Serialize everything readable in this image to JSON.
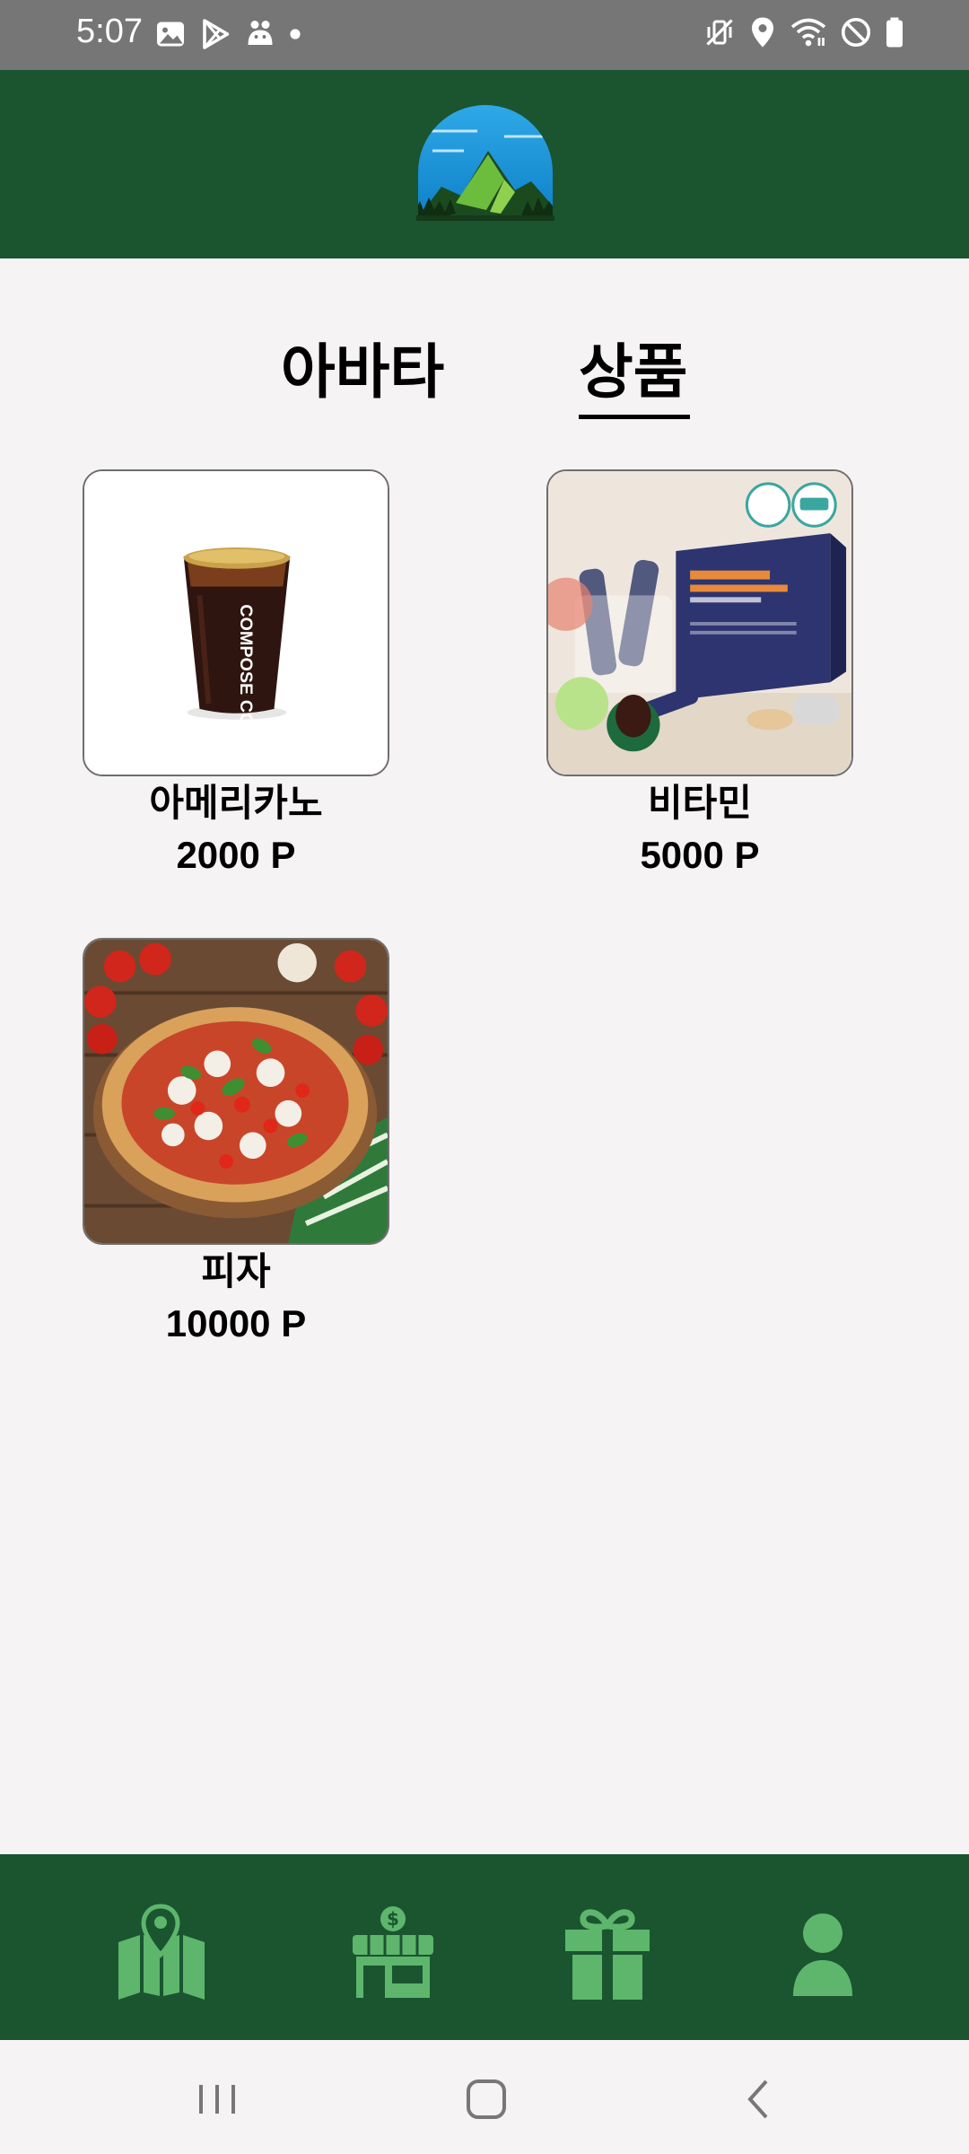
{
  "status_bar": {
    "time": "5:07",
    "left_icons": [
      "gallery-icon",
      "play-store-icon",
      "app-mascot-icon",
      "dot-icon"
    ],
    "right_icons": [
      "vibrate-mute-icon",
      "location-icon",
      "wifi-icon",
      "do-not-disturb-icon",
      "battery-icon"
    ]
  },
  "header": {
    "logo": "mountain-logo",
    "background_color": "#1a5530"
  },
  "tabs": [
    {
      "label": "아바타",
      "selected": false
    },
    {
      "label": "상품",
      "selected": true
    }
  ],
  "products": [
    {
      "name": "아메리카노",
      "price": "2000 P",
      "image": "iced-americano-cup",
      "cup_text": "COMPOSE COFFEE"
    },
    {
      "name": "비타민",
      "price": "5000 P",
      "image": "vitamin-box"
    },
    {
      "name": "피자",
      "price": "10000 P",
      "image": "pizza"
    }
  ],
  "bottom_nav": {
    "items": [
      {
        "icon": "map-icon"
      },
      {
        "icon": "store-icon"
      },
      {
        "icon": "gift-icon"
      },
      {
        "icon": "profile-icon"
      }
    ],
    "icon_color": "#5db66c"
  },
  "system_nav": {
    "buttons": [
      "recents-icon",
      "home-icon",
      "back-icon"
    ]
  }
}
